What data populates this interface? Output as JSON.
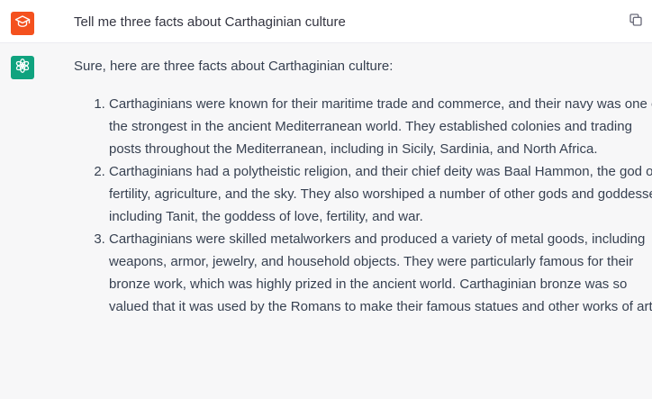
{
  "user_message": {
    "avatar_icon": "graduation-cap-icon",
    "avatar_color": "#f4511e",
    "text": "Tell me three facts about Carthaginian culture",
    "copy_icon": "copy-icon"
  },
  "assistant_message": {
    "avatar_icon": "openai-logo-icon",
    "avatar_color": "#10a37f",
    "intro": "Sure, here are three facts about Carthaginian culture:",
    "facts": [
      "Carthaginians were known for their maritime trade and commerce, and their navy was one of the strongest in the ancient Mediterranean world. They established colonies and trading posts throughout the Mediterranean, including in Sicily, Sardinia, and North Africa.",
      "Carthaginians had a polytheistic religion, and their chief deity was Baal Hammon, the god of fertility, agriculture, and the sky. They also worshiped a number of other gods and goddesses, including Tanit, the goddess of love, fertility, and war.",
      "Carthaginians were skilled metalworkers and produced a variety of metal goods, including weapons, armor, jewelry, and household objects. They were particularly famous for their bronze work, which was highly prized in the ancient world. Carthaginian bronze was so valued that it was used by the Romans to make their famous statues and other works of art."
    ]
  }
}
